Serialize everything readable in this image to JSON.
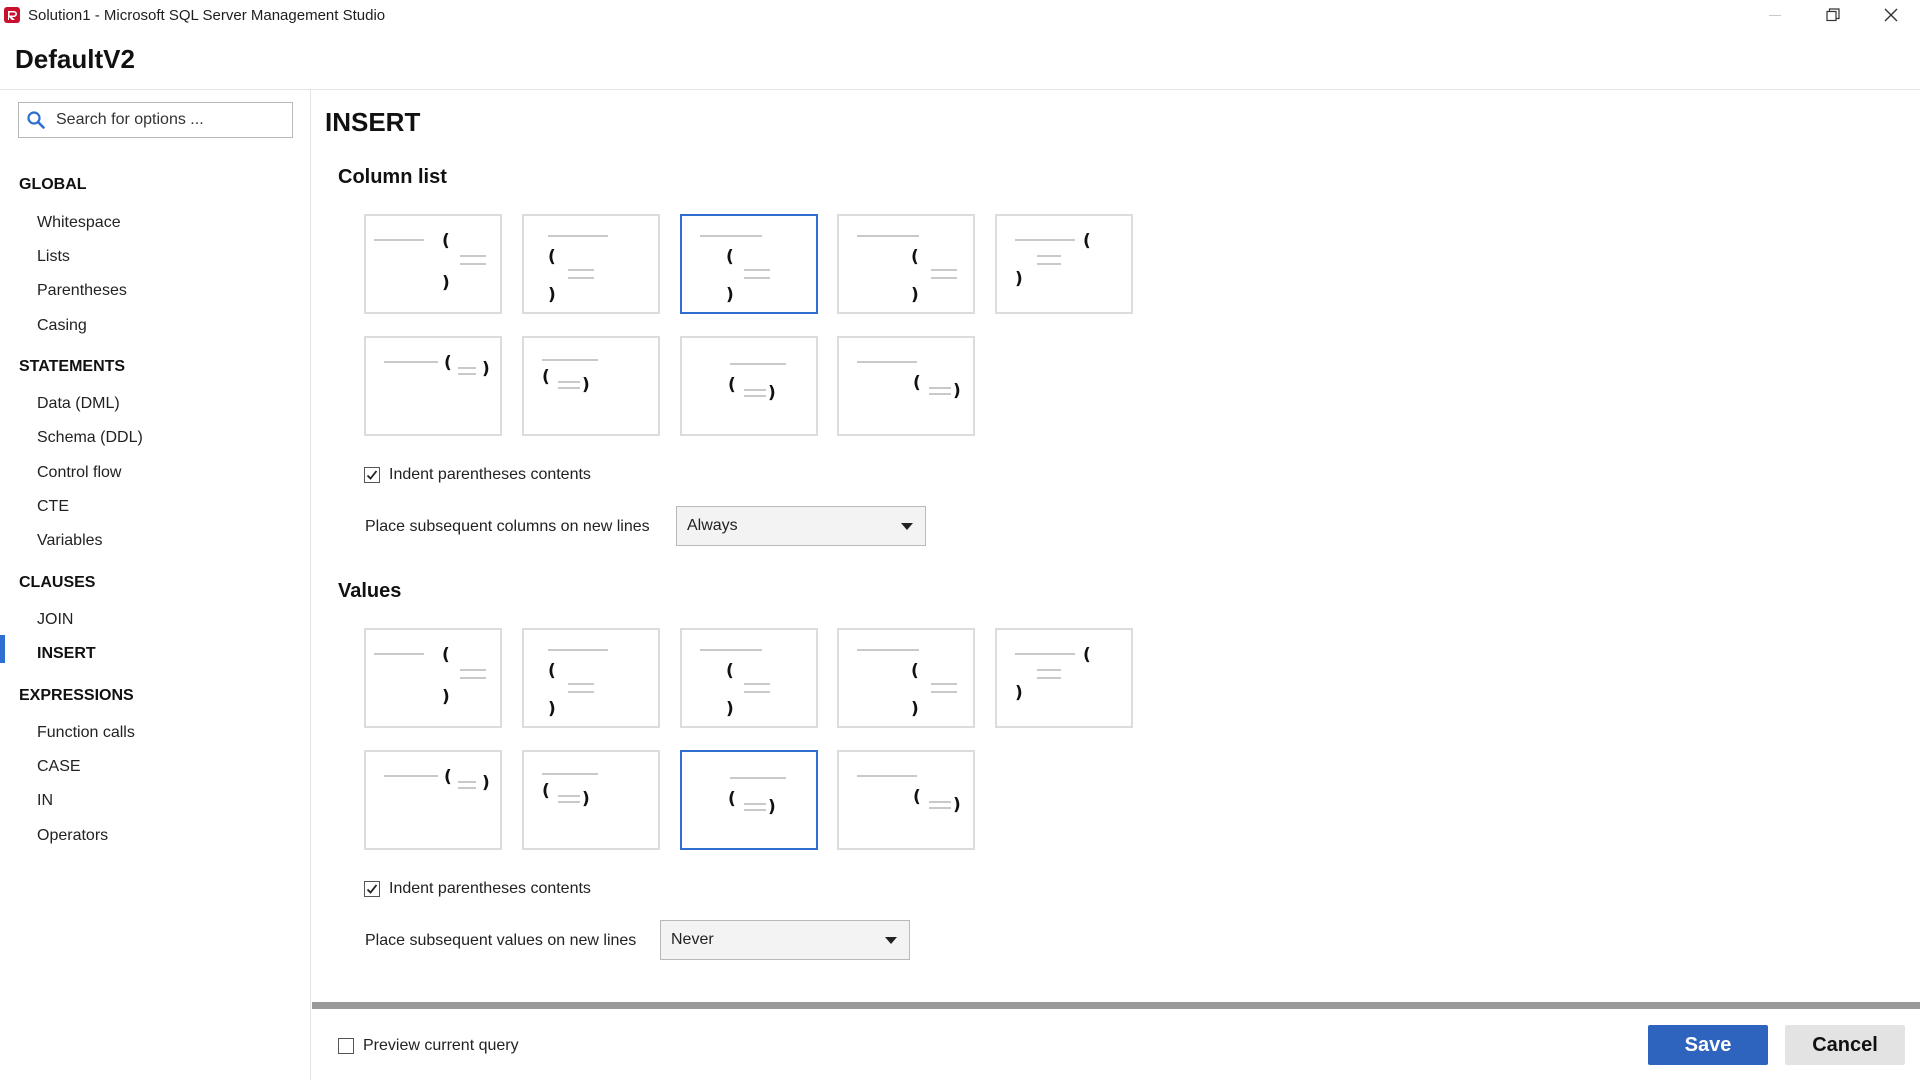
{
  "window": {
    "title": "Solution1 - Microsoft SQL Server Management Studio",
    "icon": "redgate-logo-icon",
    "controls": [
      "minimize-icon",
      "restore-icon",
      "close-icon"
    ]
  },
  "header": {
    "profile_name": "DefaultV2"
  },
  "sidebar": {
    "search_placeholder": "Search for options ...",
    "sections": [
      {
        "title": "GLOBAL",
        "items": [
          "Whitespace",
          "Lists",
          "Parentheses",
          "Casing"
        ]
      },
      {
        "title": "STATEMENTS",
        "items": [
          "Data (DML)",
          "Schema (DDL)",
          "Control flow",
          "CTE",
          "Variables"
        ]
      },
      {
        "title": "CLAUSES",
        "items": [
          "JOIN",
          "INSERT"
        ]
      },
      {
        "title": "EXPRESSIONS",
        "items": [
          "Function calls",
          "CASE",
          "IN",
          "Operators"
        ]
      }
    ],
    "active_item": "INSERT",
    "accent_color": "#2f6fd1"
  },
  "main": {
    "title": "INSERT",
    "column_list": {
      "title": "Column list",
      "selected_layout": 3,
      "indent_label": "Indent parentheses contents",
      "indent_checked": true,
      "place_label": "Place subsequent columns on new lines",
      "place_value": "Always"
    },
    "values": {
      "title": "Values",
      "selected_layout": 8,
      "indent_label": "Indent parentheses contents",
      "indent_checked": true,
      "place_label": "Place subsequent values on new lines",
      "place_value": "Never"
    }
  },
  "footer": {
    "preview_label": "Preview current query",
    "preview_checked": false,
    "save_label": "Save",
    "cancel_label": "Cancel",
    "save_color": "#2e63be"
  }
}
